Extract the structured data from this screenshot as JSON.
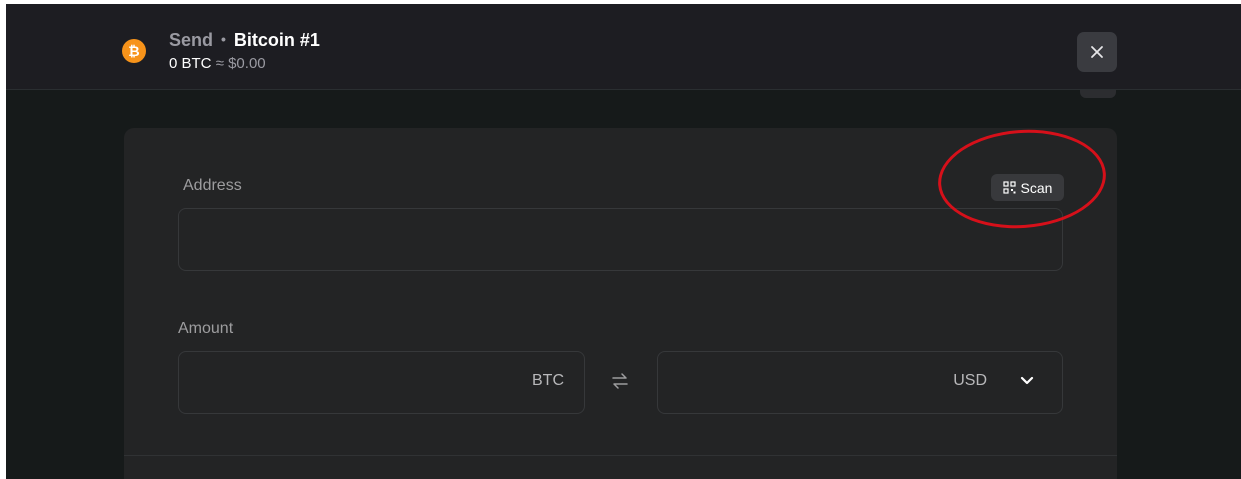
{
  "header": {
    "action": "Send",
    "separator": "•",
    "account": "Bitcoin #1",
    "balance_crypto": "0 BTC",
    "balance_approx": "≈ $0.00",
    "coin_glyph": "₿",
    "coin_color": "#f7931a"
  },
  "form": {
    "address_label": "Address",
    "scan_label": "Scan",
    "address_value": "",
    "amount_label": "Amount",
    "crypto_unit": "BTC",
    "fiat_unit": "USD",
    "crypto_value": "",
    "fiat_value": ""
  },
  "icons": {
    "close": "close-icon",
    "scan": "qr-code-icon",
    "swap": "swap-arrows-icon",
    "dropdown": "chevron-down-icon"
  },
  "annotation_color": "#d6101a"
}
